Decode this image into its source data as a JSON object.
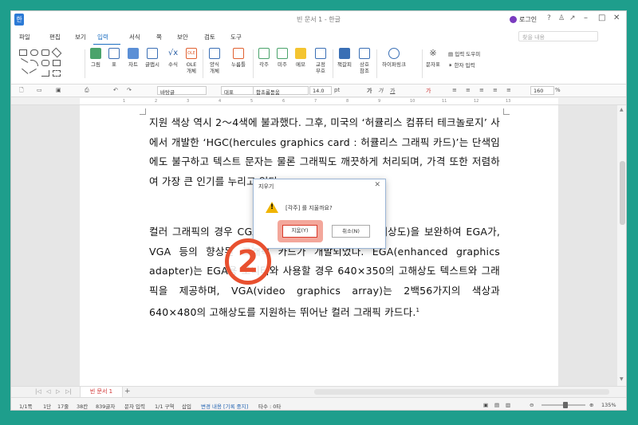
{
  "window": {
    "title": "빈 문서 1 - 한글",
    "login_label": "로그인",
    "app_icon_label": "한"
  },
  "menu": {
    "items": [
      "파일",
      "편집",
      "보기",
      "입력",
      "서식",
      "쪽",
      "보안",
      "검토",
      "도구"
    ],
    "active": "입력",
    "search_placeholder": "찾을 내용"
  },
  "ribbon": {
    "buttons": [
      {
        "label": "그림",
        "icon": "picture-icon"
      },
      {
        "label": "표",
        "icon": "table-icon"
      },
      {
        "label": "차트",
        "icon": "chart-icon"
      },
      {
        "label": "글맵시",
        "icon": "wordart-icon"
      },
      {
        "label": "수식",
        "icon": "formula-icon"
      },
      {
        "label": "OLE\n개체",
        "icon": "ole-icon"
      },
      {
        "label": "양식\n개체",
        "icon": "form-icon"
      },
      {
        "label": "누름틀",
        "icon": "field-icon"
      },
      {
        "label": "각주",
        "icon": "footnote-icon"
      },
      {
        "label": "미주",
        "icon": "endnote-icon"
      },
      {
        "label": "메모",
        "icon": "memo-icon"
      },
      {
        "label": "교정\n부호",
        "icon": "proof-icon"
      },
      {
        "label": "책갈피",
        "icon": "bookmark-icon"
      },
      {
        "label": "상호\n참조",
        "icon": "crossref-icon"
      },
      {
        "label": "하이퍼링크",
        "icon": "hyperlink-icon"
      },
      {
        "label": "문자표",
        "icon": "charmap-icon"
      }
    ],
    "input_helper": "입력 도우미",
    "hanja_input": "한자 입력"
  },
  "format": {
    "style": "바탕글",
    "lang": "대표",
    "font": "함초롬돋움",
    "size": "14.0",
    "size_unit": "pt",
    "zoom": "160",
    "zoom_unit": "%"
  },
  "document": {
    "paragraph1": "지원 색상 역시 2～4색에 불과했다. 그후, 미국의 ‘허큘리스 컴퓨터 테크놀로지’ 사에서 개발한 ‘HGC(hercules graphics card : 허큘리스 그래픽 카드)’는 단색임에도 불구하고 텍스트 문자는 물론 그래픽도 깨끗하게 처리되며, 가격 또한 저렴하여 가장 큰 인기를 누리고 있다.",
    "paragraph2": "컬러 그래픽의 경우 CGA의 지원, 낮은 텍스트 문자 해상도)을 보완하여 EGA가, VGA 등의 향상된 그래픽 카드가 개발되었다. EGA(enhanced graphics adapter)는 EGA용 모니터와 사용할 경우 640×350의 고해상도 텍스트와 그래픽을 제공하며, VGA(video graphics array)는 2백56가지의 색상과 640×480의 고해상도를 지원하는 뛰어난 컬러 그래픽 카드다.",
    "footnote_marker": "1"
  },
  "dialog": {
    "title": "지우기",
    "message": "[각주] 를 지울까요?",
    "ok_label": "지움(Y)",
    "cancel_label": "취소(N)"
  },
  "step_badge": "2",
  "tabs": {
    "doc_tab": "빈 문서 1",
    "add": "+"
  },
  "status": {
    "page": "1/1쪽",
    "section": "1단",
    "line": "17줄",
    "col": "38칸",
    "chars": "839글자",
    "mode": "문자 입력",
    "area": "1/1 구역",
    "insert": "삽입",
    "track": "변경 내용 [기록 중지]",
    "count": "타수 : 0타",
    "zoom": "135%"
  },
  "colors": {
    "background": "#1e9e8c",
    "accent": "#1d6fc2",
    "highlight": "#e8502f"
  }
}
